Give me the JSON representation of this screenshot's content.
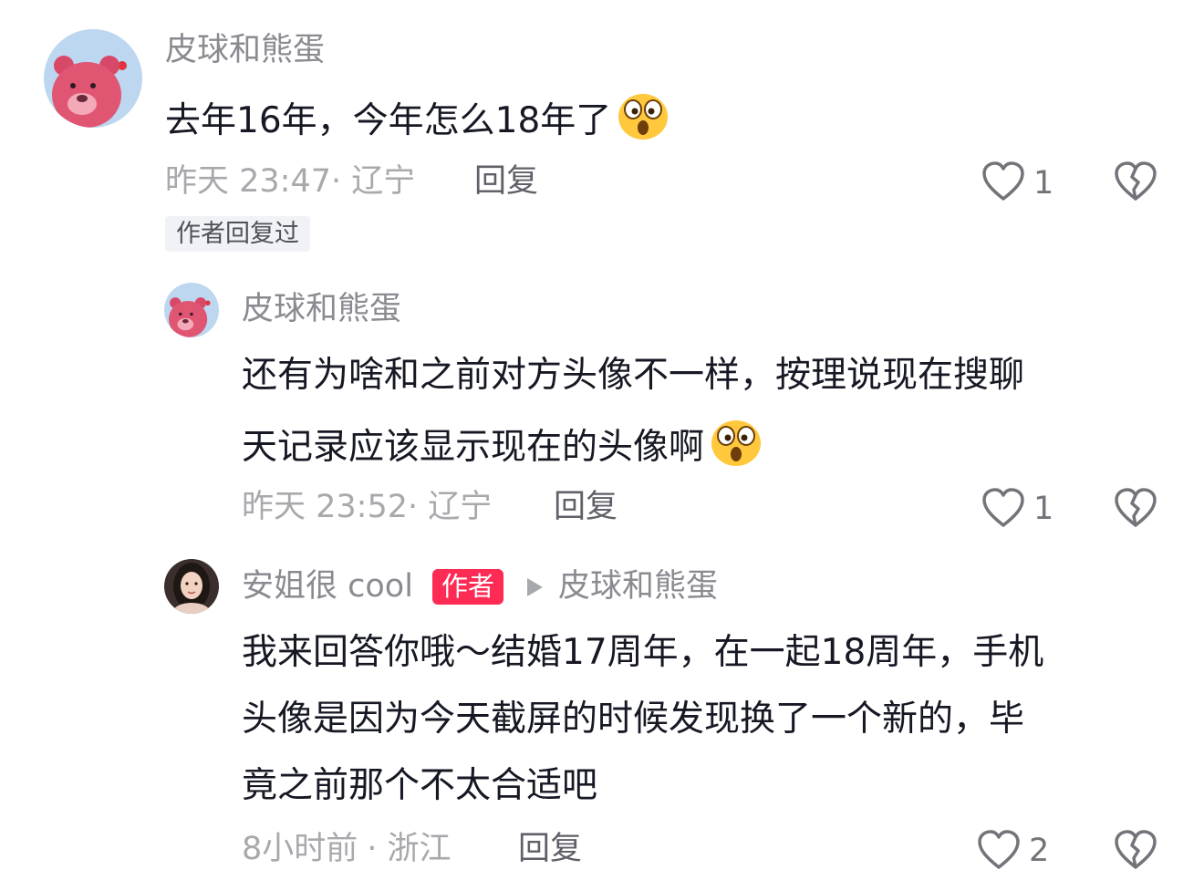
{
  "comments": [
    {
      "username": "皮球和熊蛋",
      "text": "去年16年，今年怎么18年了",
      "emoji": "astonished-emoji",
      "time": "昨天 23:47",
      "location": "· 辽宁",
      "reply_label": "回复",
      "likes": "1",
      "author_replied_tag": "作者回复过"
    },
    {
      "username": "皮球和熊蛋",
      "text_line1": "还有为啥和之前对方头像不一样，按理说现在搜聊",
      "text_line2": "天记录应该显示现在的头像啊",
      "emoji": "astonished-emoji",
      "time": "昨天 23:52",
      "location": "· 辽宁",
      "reply_label": "回复",
      "likes": "1"
    },
    {
      "username": "安姐很 cool",
      "author_badge": "作者",
      "reply_to": "皮球和熊蛋",
      "text_line1": "我来回答你哦～结婚17周年，在一起18周年，手机",
      "text_line2": "头像是因为今天截屏的时候发现换了一个新的，毕",
      "text_line3": "竟之前那个不太合适吧",
      "time": "8小时前",
      "location": "· 浙江",
      "reply_label": "回复",
      "likes": "2"
    }
  ],
  "icons": {
    "like": "heart-outline-icon",
    "dislike": "broken-heart-icon",
    "reply_arrow": "play-arrow-icon"
  },
  "colors": {
    "author_badge_bg": "#fe2c55",
    "emoji_yellow": "#ffc83d",
    "bear_pink": "#e05572",
    "sky_blue": "#bcd7ef"
  }
}
